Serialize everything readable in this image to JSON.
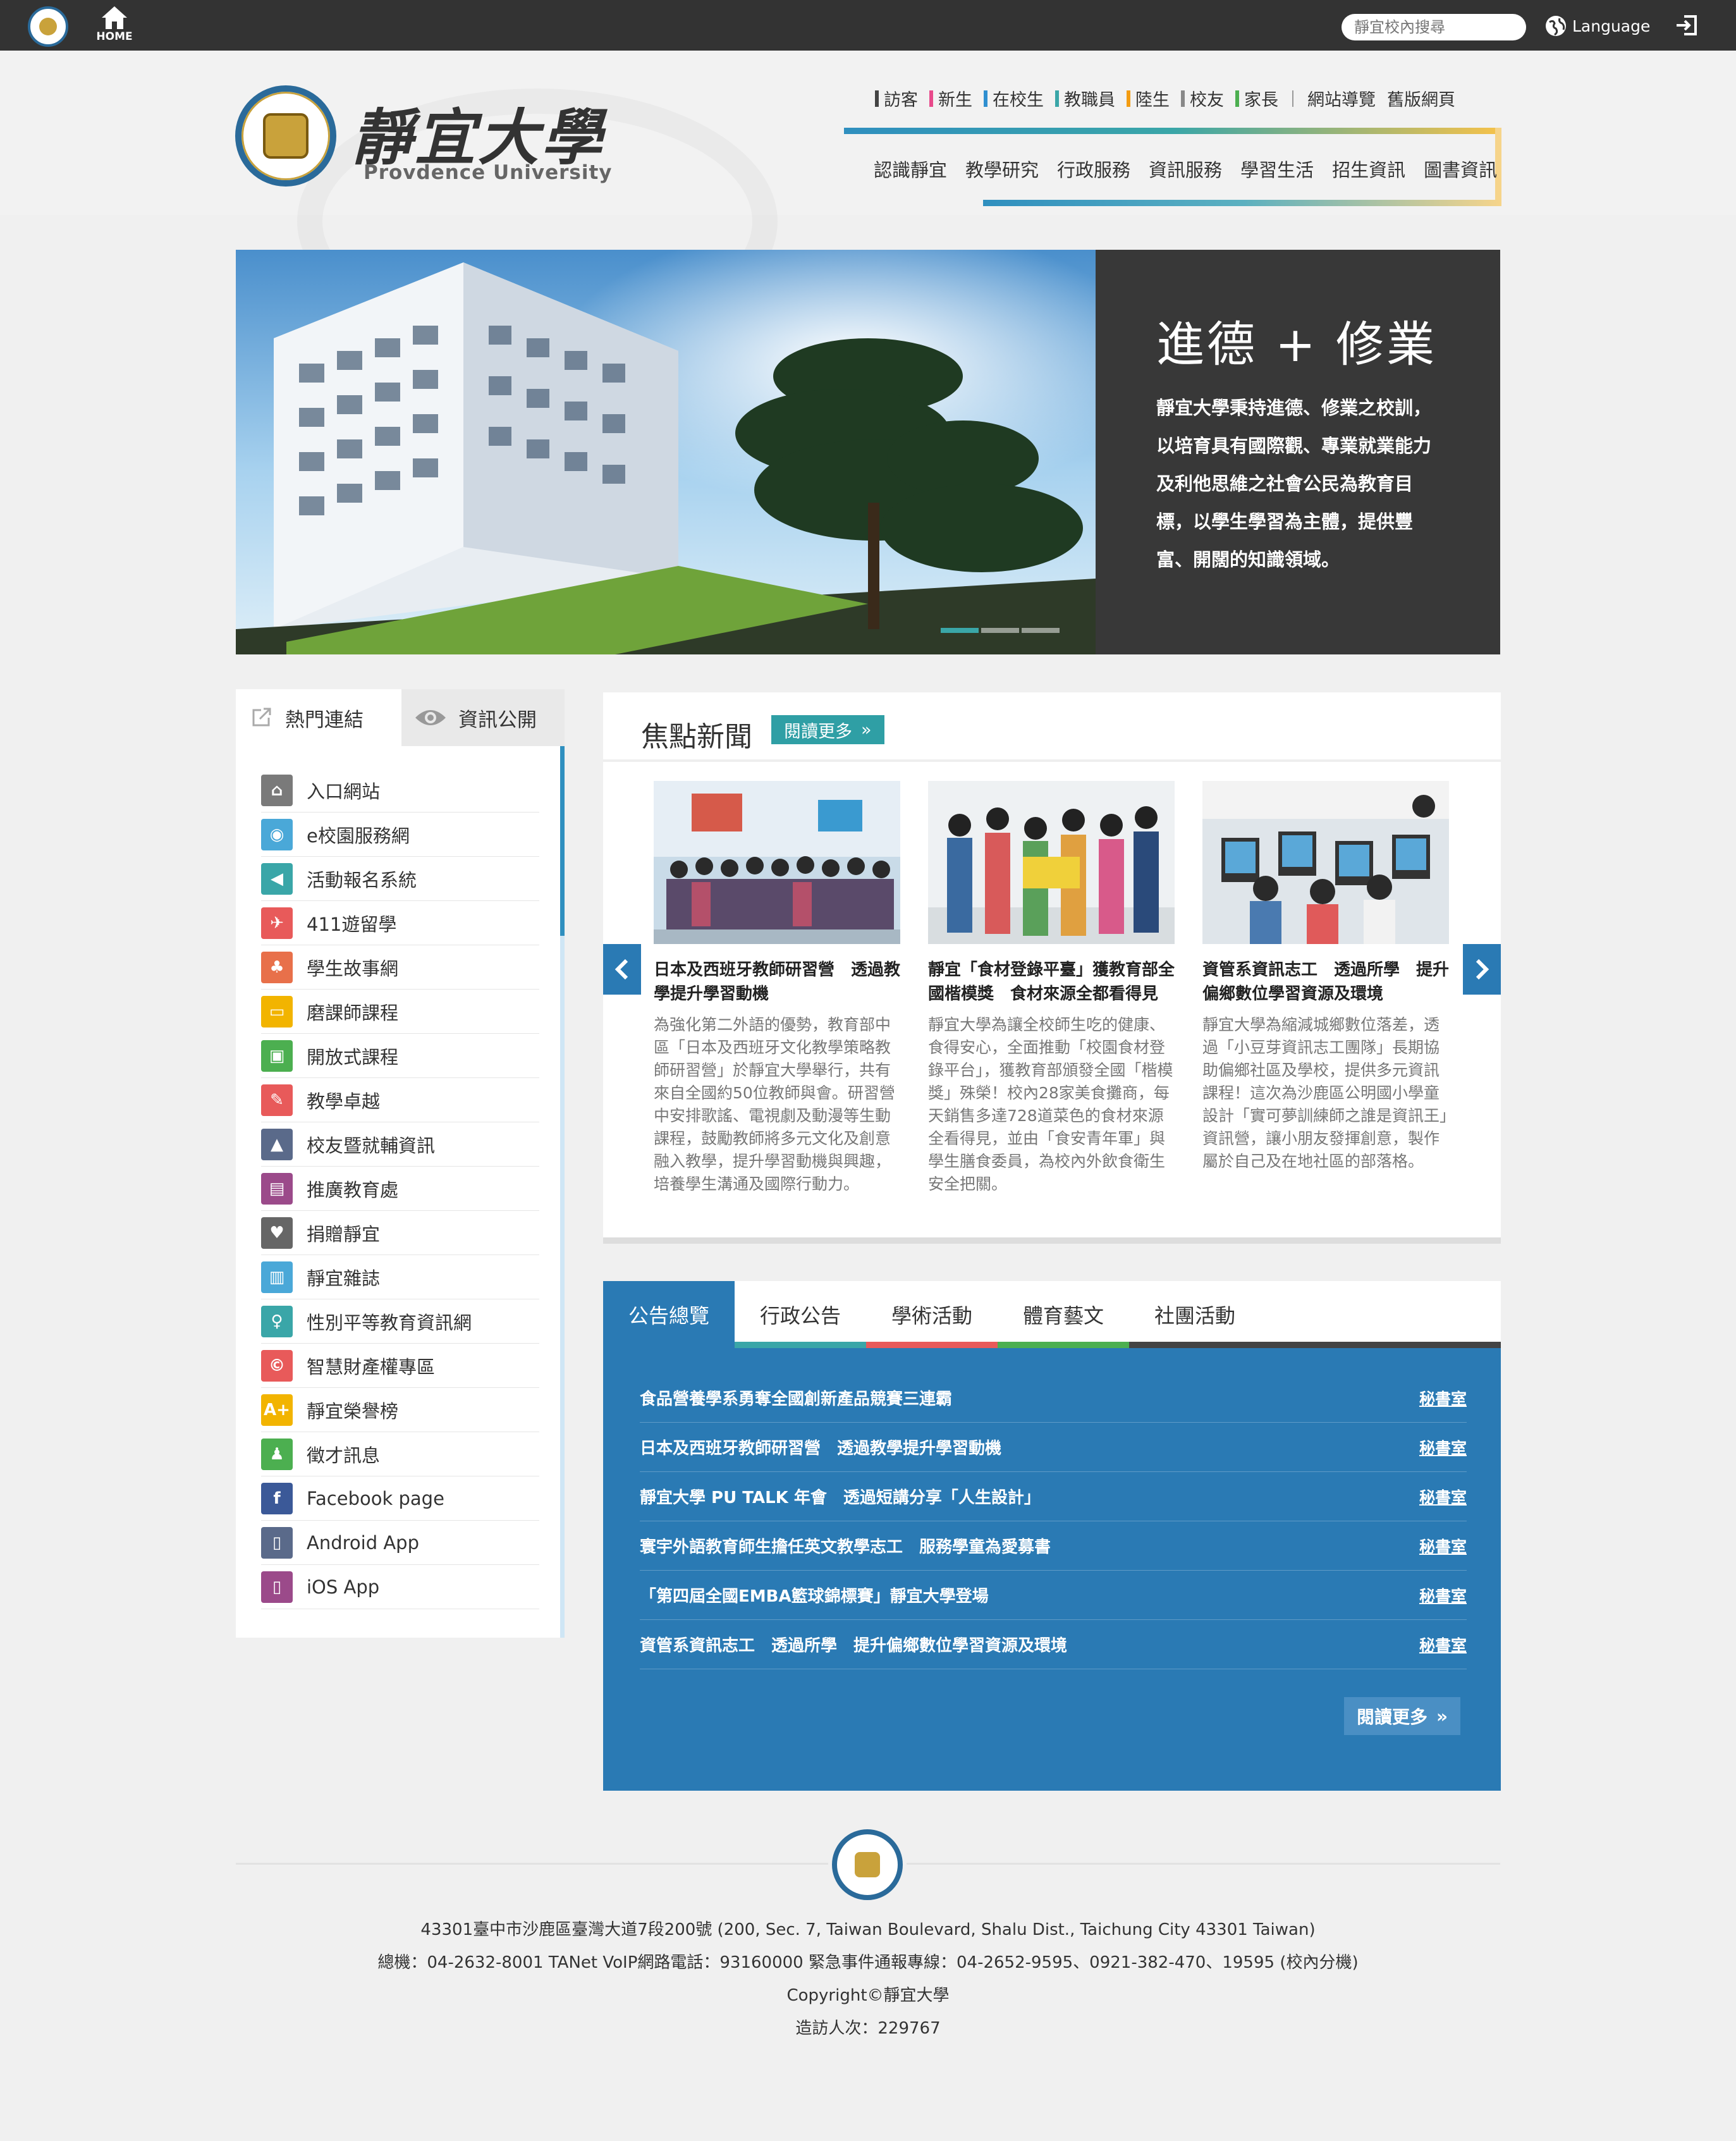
{
  "topbar": {
    "home_label": "HOME",
    "search_placeholder": "靜宜校內搜尋",
    "language_label": "Language"
  },
  "header": {
    "logo_cn": "靜宜大學",
    "logo_en": "Provdence University",
    "audiences": [
      {
        "label": "訪客",
        "color": "#444444"
      },
      {
        "label": "新生",
        "color": "#e84a8b"
      },
      {
        "label": "在校生",
        "color": "#2f8fd0"
      },
      {
        "label": "教職員",
        "color": "#3aa6a8"
      },
      {
        "label": "陸生",
        "color": "#f39c12"
      },
      {
        "label": "校友",
        "color": "#888888"
      },
      {
        "label": "家長",
        "color": "#4caf50"
      }
    ],
    "utility": [
      "網站導覽",
      "舊版網頁"
    ],
    "mainnav": [
      "認識靜宜",
      "教學研究",
      "行政服務",
      "資訊服務",
      "學習生活",
      "招生資訊",
      "圖書資訊"
    ]
  },
  "hero": {
    "title": "進德 + 修業",
    "text": "靜宜大學秉持進德、修業之校訓，以培育具有國際觀、專業就業能力及利他思維之社會公民為教育目標，以學生學習為主體，提供豐富、開闊的知識領域。"
  },
  "sidebar": {
    "tabs": [
      "熱門連結",
      "資訊公開"
    ],
    "links": [
      {
        "label": "入口網站",
        "color": "#7a7a7a",
        "glyph": "⌂"
      },
      {
        "label": "e校園服務網",
        "color": "#4aa8d8",
        "glyph": "◉"
      },
      {
        "label": "活動報名系統",
        "color": "#3aa6a8",
        "glyph": "◀"
      },
      {
        "label": "411遊留學",
        "color": "#e85a5a",
        "glyph": "✈"
      },
      {
        "label": "學生故事網",
        "color": "#e8704a",
        "glyph": "♣"
      },
      {
        "label": "磨課師課程",
        "color": "#f2b400",
        "glyph": "▭"
      },
      {
        "label": "開放式課程",
        "color": "#4caf50",
        "glyph": "▣"
      },
      {
        "label": "教學卓越",
        "color": "#e85a5a",
        "glyph": "✎"
      },
      {
        "label": "校友暨就輔資訊",
        "color": "#5a6a8a",
        "glyph": "▲"
      },
      {
        "label": "推廣教育處",
        "color": "#9b4a8a",
        "glyph": "▤"
      },
      {
        "label": "捐贈靜宜",
        "color": "#666666",
        "glyph": "♥"
      },
      {
        "label": "靜宜雜誌",
        "color": "#4aa8d8",
        "glyph": "▥"
      },
      {
        "label": "性別平等教育資訊網",
        "color": "#3aa6a8",
        "glyph": "♀"
      },
      {
        "label": "智慧財產權專區",
        "color": "#e85a5a",
        "glyph": "©"
      },
      {
        "label": "靜宜榮譽榜",
        "color": "#f2b400",
        "glyph": "A+"
      },
      {
        "label": "徵才訊息",
        "color": "#4caf50",
        "glyph": "♟"
      },
      {
        "label": "Facebook page",
        "color": "#3b5998",
        "glyph": "f"
      },
      {
        "label": "Android App",
        "color": "#5a6a8a",
        "glyph": "▯"
      },
      {
        "label": "iOS App",
        "color": "#9b4a8a",
        "glyph": "▯"
      }
    ]
  },
  "news": {
    "title": "焦點新聞",
    "more": "閱讀更多",
    "items": [
      {
        "title": "日本及西班牙教師研習營　透過教學提升學習動機",
        "summary": "為強化第二外語的優勢，教育部中區「日本及西班牙文化教學策略教師研習營」於靜宜大學舉行，共有來自全國約50位教師與會。研習營中安排歌謠、電視劇及動漫等生動課程，鼓勵教師將多元文化及創意融入教學，提升學習動機與興趣，培養學生溝通及國際行動力。"
      },
      {
        "title": "靜宜「食材登錄平臺」獲教育部全國楷模獎　食材來源全都看得見",
        "summary": "靜宜大學為讓全校師生吃的健康、食得安心，全面推動「校園食材登錄平台」，獲教育部頒發全國「楷模獎」殊榮！校內28家美食攤商，每天銷售多達728道菜色的食材來源全看得見，並由「食安青年軍」與學生膳食委員，為校內外飲食衛生安全把關。"
      },
      {
        "title": "資管系資訊志工　透過所學　提升偏鄉數位學習資源及環境",
        "summary": "靜宜大學為縮減城鄉數位落差，透過「小豆芽資訊志工團隊」長期協助偏鄉社區及學校，提供多元資訊課程！這次為沙鹿區公明國小學童設計「實可夢訓練師之誰是資訊王」資訊營，讓小朋友發揮創意，製作屬於自己及在地社區的部落格。"
      }
    ]
  },
  "announcements": {
    "tabs": [
      {
        "label": "公告總覽",
        "color": "#2a7ab4"
      },
      {
        "label": "行政公告",
        "color": "#3aa6a8"
      },
      {
        "label": "學術活動",
        "color": "#e85a5a"
      },
      {
        "label": "體育藝文",
        "color": "#4caf50"
      },
      {
        "label": "社團活動",
        "color": "#444444"
      }
    ],
    "items": [
      {
        "title": "食品營養學系勇奪全國創新產品競賽三連霸",
        "dept": "秘書室"
      },
      {
        "title": "日本及西班牙教師研習營　透過教學提升學習動機",
        "dept": "秘書室"
      },
      {
        "title": "靜宜大學 PU TALK 年會　透過短講分享「人生設計」",
        "dept": "秘書室"
      },
      {
        "title": "寰宇外語教育師生擔任英文教學志工　服務學童為愛募書",
        "dept": "秘書室"
      },
      {
        "title": "「第四屆全國EMBA籃球錦標賽」靜宜大學登場",
        "dept": "秘書室"
      },
      {
        "title": "資管系資訊志工　透過所學　提升偏鄉數位學習資源及環境",
        "dept": "秘書室"
      }
    ],
    "more": "閱讀更多"
  },
  "footer": {
    "address": "43301臺中市沙鹿區臺灣大道7段200號 (200, Sec. 7, Taiwan Boulevard, Shalu Dist., Taichung City 43301 Taiwan)",
    "phones": "總機：04-2632-8001 TANet VoIP網路電話：93160000 緊急事件通報專線：04-2652-9595、0921-382-470、19595 (校內分機)",
    "copyright": "Copyright©靜宜大學",
    "visitors": "造訪人次：229767"
  }
}
